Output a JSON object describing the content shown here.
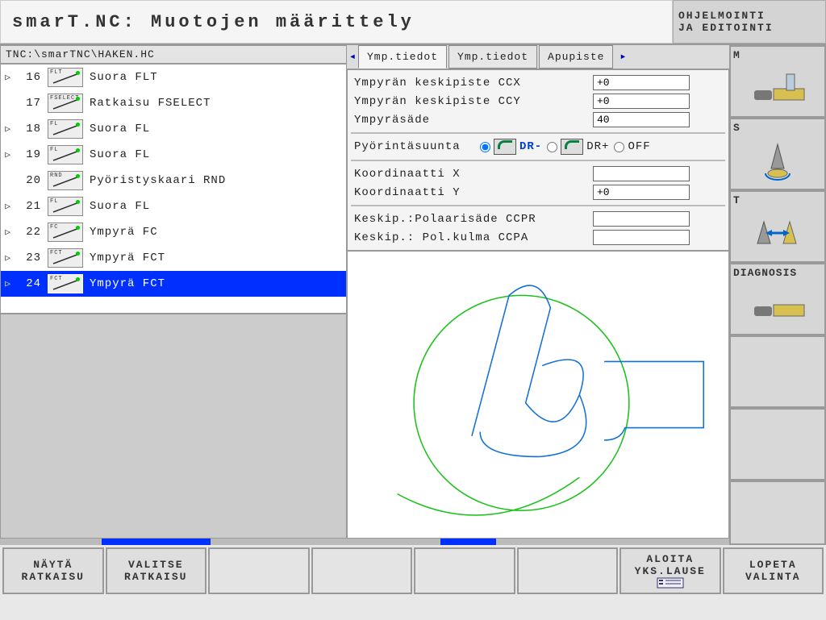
{
  "title": "smarT.NC: Muotojen määrittely",
  "header_right": {
    "line1": "OHJELMOINTI",
    "line2": "JA EDITOINTI"
  },
  "path": "TNC:\\smarTNC\\HAKEN.HC",
  "tree": [
    {
      "tri": "▷",
      "num": "16",
      "tag": "FLT",
      "label": "Suora FLT",
      "sel": false
    },
    {
      "tri": "",
      "num": "17",
      "tag": "FSELECT",
      "label": "Ratkaisu FSELECT",
      "sel": false
    },
    {
      "tri": "▷",
      "num": "18",
      "tag": "FL",
      "label": "Suora FL",
      "sel": false
    },
    {
      "tri": "▷",
      "num": "19",
      "tag": "FL",
      "label": "Suora FL",
      "sel": false
    },
    {
      "tri": "",
      "num": "20",
      "tag": "RND",
      "label": "Pyöristyskaari RND",
      "sel": false
    },
    {
      "tri": "▷",
      "num": "21",
      "tag": "FL",
      "label": "Suora FL",
      "sel": false
    },
    {
      "tri": "▷",
      "num": "22",
      "tag": "FC",
      "label": "Ympyrä FC",
      "sel": false
    },
    {
      "tri": "▷",
      "num": "23",
      "tag": "FCT",
      "label": "Ympyrä FCT",
      "sel": false
    },
    {
      "tri": "▷",
      "num": "24",
      "tag": "FCT",
      "label": "Ympyrä FCT",
      "sel": true
    }
  ],
  "tabs": {
    "t1": "Ymp.tiedot",
    "t2": "Ymp.tiedot",
    "t3": "Apupiste"
  },
  "form": {
    "ccx_label": "Ympyrän keskipiste CCX",
    "ccx": "+0",
    "ccy_label": "Ympyrän keskipiste CCY",
    "ccy": "+0",
    "rad_label": "Ympyräsäde",
    "rad": "40",
    "rot_label": "Pyörintäsuunta",
    "drm": "DR-",
    "drp": "DR+",
    "off": "OFF",
    "kx_label": "Koordinaatti X",
    "kx": "",
    "ky_label": "Koordinaatti Y",
    "ky": "+0",
    "ccpr_label": "Keskip.:Polaarisäde CCPR",
    "ccpr": "",
    "ccpa_label": "Keskip.: Pol.kulma CCPA",
    "ccpa": ""
  },
  "side": {
    "m": "M",
    "s": "S",
    "t": "T",
    "diag": "DIAGNOSIS"
  },
  "soft": {
    "k1a": "NÄYTÄ",
    "k1b": "RATKAISU",
    "k2a": "VALITSE",
    "k2b": "RATKAISU",
    "k7a": "ALOITA",
    "k7b": "YKS.LAUSE",
    "k8a": "LOPETA",
    "k8b": "VALINTA"
  }
}
